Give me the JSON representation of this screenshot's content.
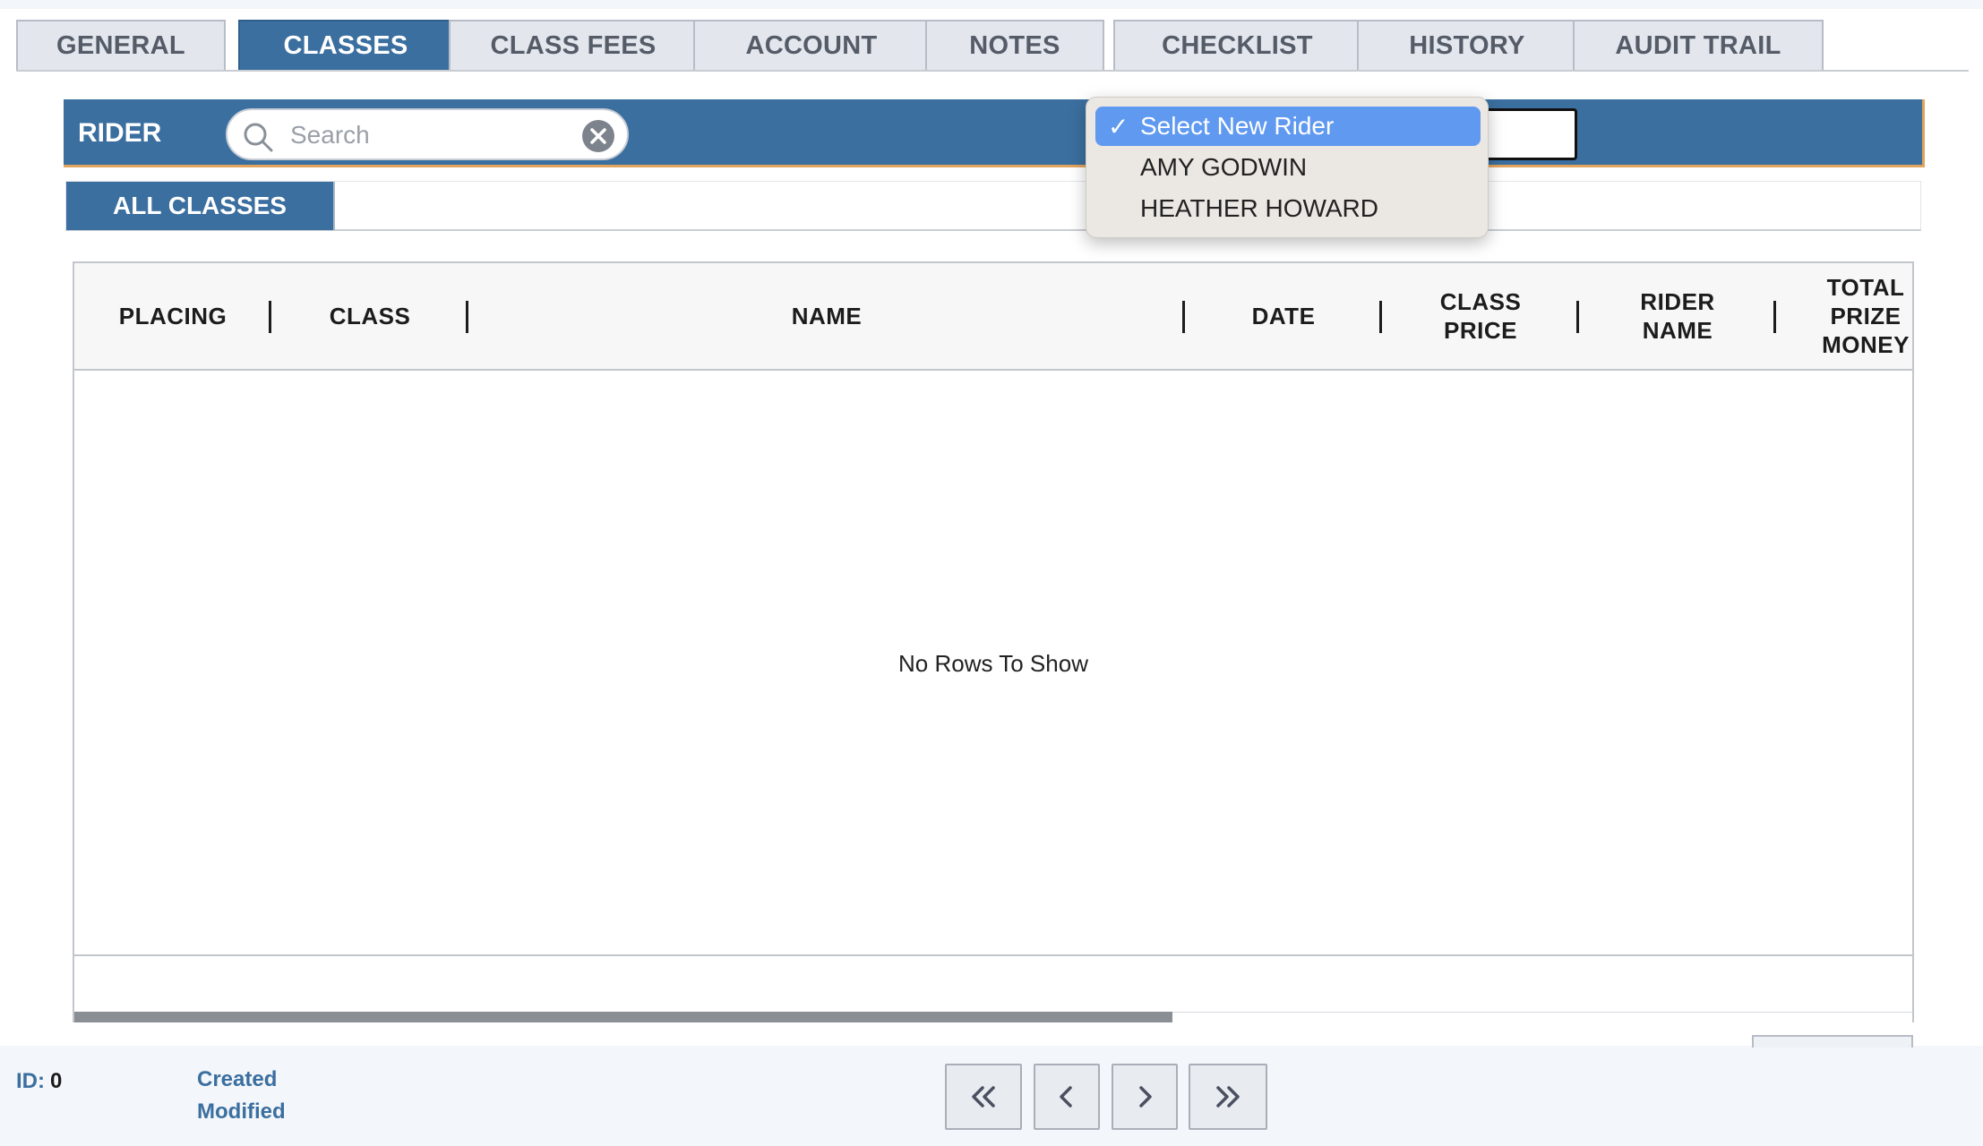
{
  "tabs": [
    {
      "label": "GENERAL",
      "active": false
    },
    {
      "label": "CLASSES",
      "active": true
    },
    {
      "label": "CLASS FEES",
      "active": false
    },
    {
      "label": "ACCOUNT",
      "active": false
    },
    {
      "label": "NOTES",
      "active": false
    },
    {
      "label": "CHECKLIST",
      "active": false
    },
    {
      "label": "HISTORY",
      "active": false
    },
    {
      "label": "AUDIT TRAIL",
      "active": false
    }
  ],
  "rider_bar": {
    "label": "RIDER",
    "search": {
      "value": "",
      "placeholder": "Search",
      "icon": "search-icon",
      "clear_icon": "clear-icon"
    }
  },
  "rider_dropdown": {
    "selected": "Select New Rider",
    "check": "✓",
    "options": [
      "Select New Rider",
      "AMY GODWIN",
      "HEATHER HOWARD"
    ]
  },
  "subtabs": [
    {
      "label": "ALL CLASSES",
      "active": true
    }
  ],
  "grid": {
    "columns": [
      {
        "label": "PLACING"
      },
      {
        "label": "CLASS"
      },
      {
        "label": "NAME"
      },
      {
        "label": "DATE"
      },
      {
        "label": "CLASS PRICE"
      },
      {
        "label": "RIDER NAME"
      },
      {
        "label": "TOTAL PRIZE MONEY"
      }
    ],
    "rows": [],
    "empty_message": "No Rows To Show"
  },
  "footer": {
    "id_label": "ID:",
    "id_value": "0",
    "created_label": "Created",
    "modified_label": "Modified",
    "nav": [
      "first-page",
      "previous-page",
      "next-page",
      "last-page"
    ]
  },
  "colors": {
    "accent": "#3b6f9f",
    "accent_border": "#e2a35c",
    "dropdown_selected": "#5f99f0"
  }
}
